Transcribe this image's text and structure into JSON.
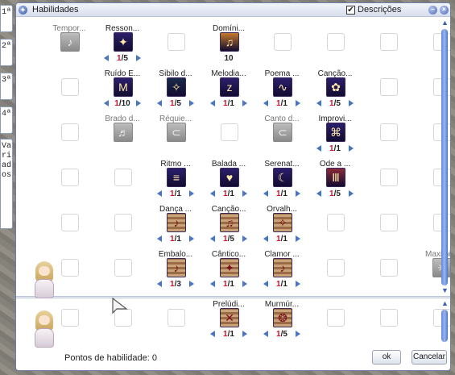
{
  "window": {
    "title": "Habilidades",
    "descriptions_checkbox_label": "Descrições",
    "descriptions_checked": true
  },
  "tabs": [
    "1ª",
    "2ª",
    "3ª",
    "4ª",
    "Variados"
  ],
  "skills": [
    {
      "name": "Tempor...",
      "level": "",
      "max": "",
      "dim": true,
      "icon": "passive-song-icon"
    },
    {
      "name": "Resson...",
      "level": "1",
      "max": "5",
      "dim": false,
      "icon": "resonance-icon"
    },
    {
      "name": "Domíni...",
      "level": "10",
      "max": "",
      "dim": false,
      "icon": "music-mastery-icon"
    },
    {
      "name": "Ruído E...",
      "level": "1",
      "max": "10",
      "dim": false,
      "icon": "noise-icon"
    },
    {
      "name": "Sibilo d...",
      "level": "1",
      "max": "5",
      "dim": false,
      "icon": "whistle-icon"
    },
    {
      "name": "Melodia...",
      "level": "1",
      "max": "1",
      "dim": false,
      "icon": "lullaby-icon"
    },
    {
      "name": "Poema ...",
      "level": "1",
      "max": "1",
      "dim": false,
      "icon": "poem-icon"
    },
    {
      "name": "Canção...",
      "level": "1",
      "max": "5",
      "dim": false,
      "icon": "song-icon"
    },
    {
      "name": "Brado d...",
      "level": "",
      "max": "",
      "dim": true,
      "icon": "shout-icon"
    },
    {
      "name": "Réquie...",
      "level": "",
      "max": "",
      "dim": true,
      "icon": "requiem-icon"
    },
    {
      "name": "Canto d...",
      "level": "",
      "max": "",
      "dim": true,
      "icon": "chant-icon"
    },
    {
      "name": "Improvi...",
      "level": "1",
      "max": "1",
      "dim": false,
      "icon": "improvise-icon"
    },
    {
      "name": "Ritmo ...",
      "level": "1",
      "max": "1",
      "dim": false,
      "icon": "rhythm-icon"
    },
    {
      "name": "Balada ...",
      "level": "1",
      "max": "1",
      "dim": false,
      "icon": "ballad-icon"
    },
    {
      "name": "Serenat...",
      "level": "1",
      "max": "1",
      "dim": false,
      "icon": "serenade-icon"
    },
    {
      "name": "Ode a ...",
      "level": "1",
      "max": "5",
      "dim": false,
      "icon": "ode-icon"
    },
    {
      "name": "Dança ...",
      "level": "1",
      "max": "1",
      "dim": false,
      "icon": "dance-icon"
    },
    {
      "name": "Canção...",
      "level": "1",
      "max": "5",
      "dim": false,
      "icon": "song2-icon"
    },
    {
      "name": "Orvalh...",
      "level": "1",
      "max": "1",
      "dim": false,
      "icon": "dew-icon"
    },
    {
      "name": "Embalo...",
      "level": "1",
      "max": "3",
      "dim": false,
      "icon": "lull-icon"
    },
    {
      "name": "Cântico...",
      "level": "1",
      "max": "1",
      "dim": false,
      "icon": "canticle-icon"
    },
    {
      "name": "Clamor ...",
      "level": "1",
      "max": "1",
      "dim": false,
      "icon": "clamor-icon"
    },
    {
      "name": "Maximi...",
      "level": "",
      "max": "",
      "dim": true,
      "icon": "maximize-icon"
    },
    {
      "name": "Prelúdi...",
      "level": "1",
      "max": "1",
      "dim": false,
      "icon": "prelude-icon"
    },
    {
      "name": "Murmúr...",
      "level": "1",
      "max": "5",
      "dim": false,
      "icon": "murmur-icon"
    }
  ],
  "footer": {
    "points_label": "Pontos de habilidade: 0",
    "ok_label": "ok",
    "cancel_label": "Cancelar"
  }
}
